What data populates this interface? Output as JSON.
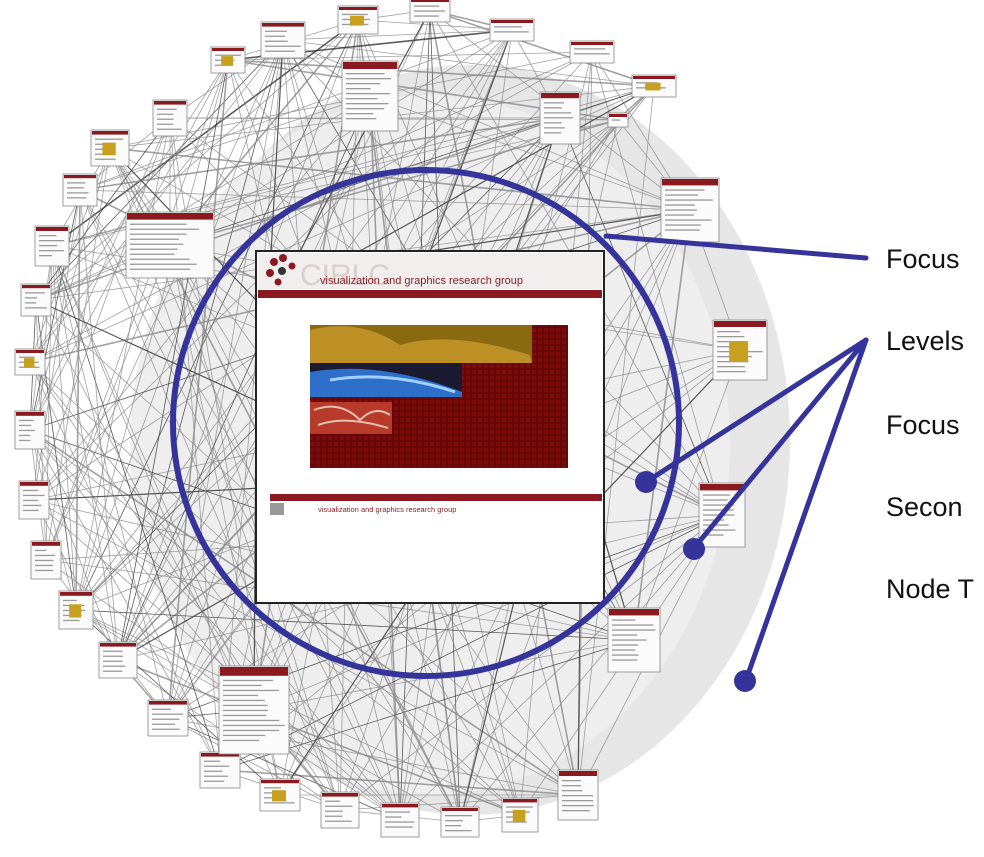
{
  "focus_page": {
    "logo_text": "CIRLC",
    "header_title": "visualization and graphics research group",
    "footer_title": "visualization and graphics research group"
  },
  "labels": [
    {
      "text": "Focus"
    },
    {
      "text": "Levels"
    },
    {
      "text": "Focus"
    },
    {
      "text": "Secon"
    },
    {
      "text": "Node T"
    }
  ],
  "colors": {
    "accent": "#35349a",
    "page_header": "#8a1a1f",
    "edge": "#8a8a8a",
    "halo": "#e6e6e6"
  }
}
